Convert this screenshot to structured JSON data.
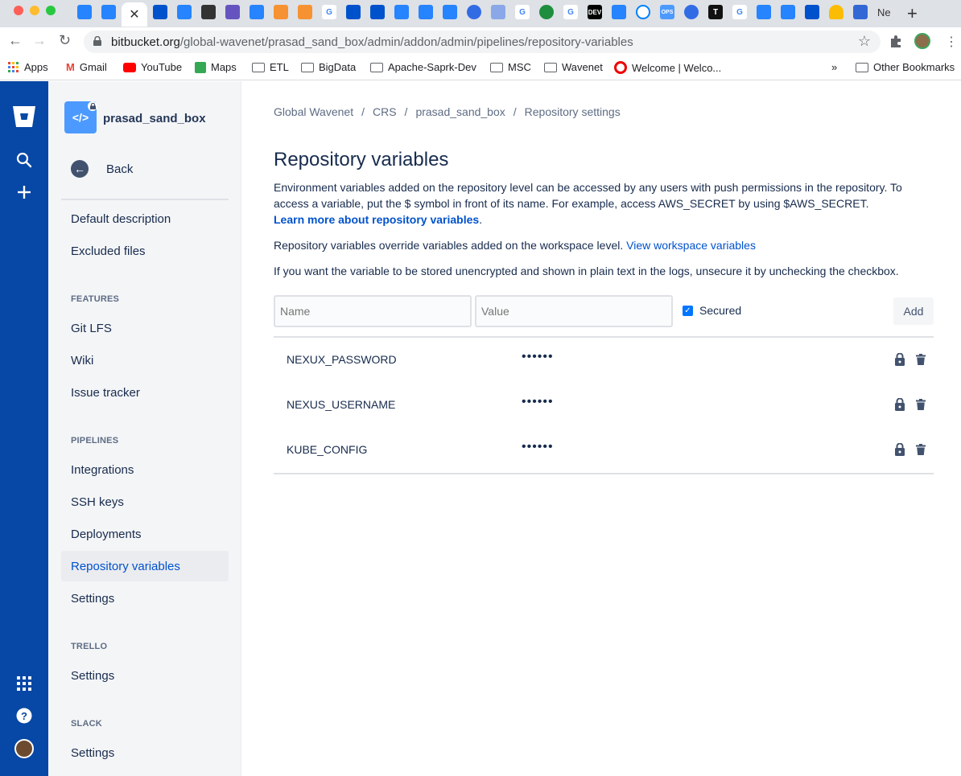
{
  "browser": {
    "tab_overflow_text": "Ne",
    "url_host": "bitbucket.org",
    "url_path": "/global-wavenet/prasad_sand_box/admin/addon/admin/pipelines/repository-variables",
    "bookmarks": [
      "Apps",
      "Gmail",
      "YouTube",
      "Maps",
      "ETL",
      "BigData",
      "Apache-Saprk-Dev",
      "MSC",
      "Wavenet",
      "Welcome | Welco..."
    ],
    "more_bookmarks": "»",
    "other_bookmarks": "Other Bookmarks"
  },
  "repo": {
    "name": "prasad_sand_box",
    "icon_glyph": "</>"
  },
  "sidebar": {
    "back_label": "Back",
    "top_items": [
      "Default description",
      "Excluded files"
    ],
    "features_heading": "FEATURES",
    "features_items": [
      "Git LFS",
      "Wiki",
      "Issue tracker"
    ],
    "pipelines_heading": "PIPELINES",
    "pipelines_items": [
      "Integrations",
      "SSH keys",
      "Deployments",
      "Repository variables",
      "Settings"
    ],
    "selected_item": "Repository variables",
    "trello_heading": "TRELLO",
    "trello_items": [
      "Settings"
    ],
    "slack_heading": "SLACK",
    "slack_items": [
      "Settings"
    ]
  },
  "breadcrumb": [
    "Global Wavenet",
    "CRS",
    "prasad_sand_box",
    "Repository settings"
  ],
  "page": {
    "title": "Repository variables",
    "desc_1": "Environment variables added on the repository level can be accessed by any users with push permissions in the repository. To access a variable, put the $ symbol in front of its name. For example, access AWS_SECRET by using $AWS_SECRET.",
    "learn_more_link": "Learn more about repository variables",
    "desc_2": "Repository variables override variables added on the workspace level.",
    "workspace_link": "View workspace variables",
    "desc_3": "If you want the variable to be stored unencrypted and shown in plain text in the logs, unsecure it by unchecking the checkbox."
  },
  "form": {
    "name_placeholder": "Name",
    "value_placeholder": "Value",
    "secured_label": "Secured",
    "secured_checked": true,
    "add_label": "Add"
  },
  "variables": [
    {
      "name": "NEXUX_PASSWORD",
      "value": "••••••"
    },
    {
      "name": "NEXUS_USERNAME",
      "value": "••••••"
    },
    {
      "name": "KUBE_CONFIG",
      "value": "••••••"
    }
  ],
  "colors": {
    "global_nav": "#0747A6",
    "link": "#0052CC",
    "checkbox": "#0075FF"
  }
}
